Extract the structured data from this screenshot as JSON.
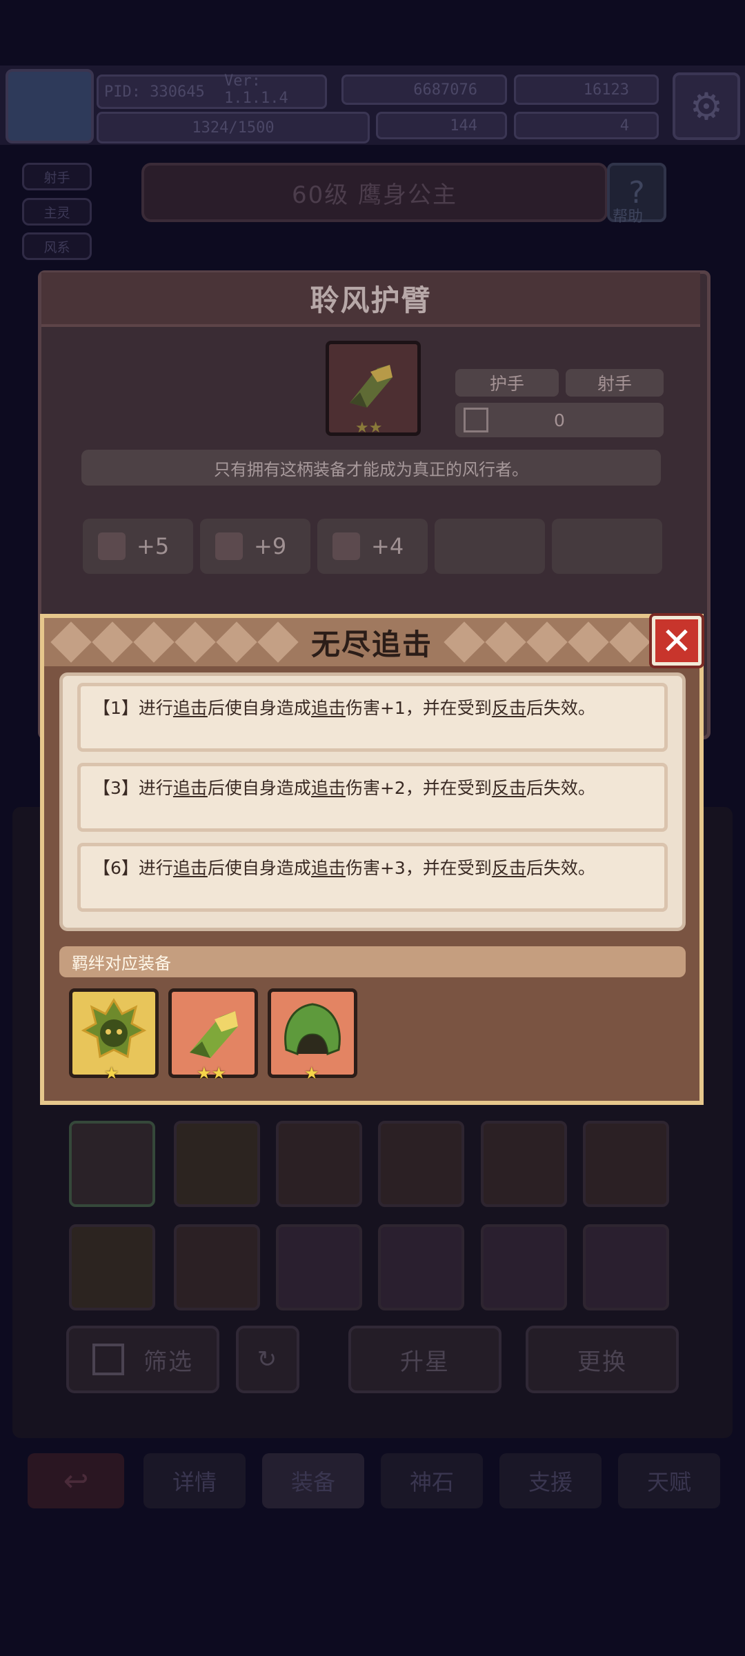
{
  "header": {
    "pid": "PID: 330645",
    "version": "Ver: 1.1.1.4",
    "coins": "6687076",
    "gems": "16123",
    "exp": "1324/1500",
    "shards": "144",
    "keys": "4"
  },
  "side_tags": [
    "射手",
    "主灵",
    "风系"
  ],
  "hero": {
    "title": "60级  鹰身公主",
    "help_label": "帮助"
  },
  "equipment": {
    "name": "聆风护臂",
    "type_tag": "护手",
    "class_tag": "射手",
    "value": "0",
    "description": "只有拥有这柄装备才能成为真正的风行者。",
    "stats": [
      "+5",
      "+9",
      "+4"
    ],
    "item_stars": "★★"
  },
  "modal": {
    "title": "无尽追击",
    "close_icon": "close-icon",
    "effects": [
      {
        "prefix": "【1】进行",
        "kw1": "追击",
        "mid1": "后使自身造成",
        "kw2": "追击",
        "mid2": "伤害+1，并在受到",
        "kw3": "反击",
        "suffix": "后失效。"
      },
      {
        "prefix": "【3】进行",
        "kw1": "追击",
        "mid1": "后使自身造成",
        "kw2": "追击",
        "mid2": "伤害+2，并在受到",
        "kw3": "反击",
        "suffix": "后失效。"
      },
      {
        "prefix": "【6】进行",
        "kw1": "追击",
        "mid1": "后使自身造成",
        "kw2": "追击",
        "mid2": "伤害+3，并在受到",
        "kw3": "反击",
        "suffix": "后失效。"
      }
    ],
    "bond_title": "羁绊对应装备",
    "bond_items": [
      {
        "icon": "spiked-helmet-icon",
        "stars": "★",
        "bg": "#e8c55a"
      },
      {
        "icon": "bracer-icon",
        "stars": "★★",
        "bg": "#e38463"
      },
      {
        "icon": "green-hood-icon",
        "stars": "★",
        "bg": "#e38463"
      }
    ]
  },
  "bottom_buttons": {
    "filter": "筛选",
    "upgrade": "升星",
    "replace": "更换"
  },
  "tabs": [
    "详情",
    "装备",
    "神石",
    "支援",
    "天赋"
  ]
}
